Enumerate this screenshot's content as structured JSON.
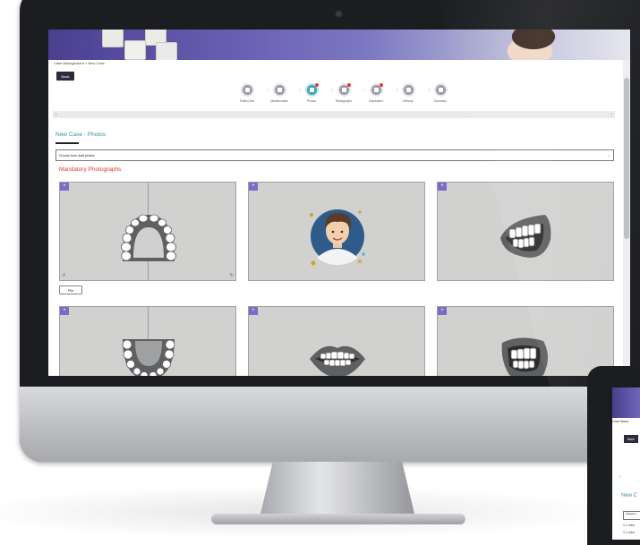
{
  "breadcrumb": "Case Management > New Case",
  "back_label": "Back",
  "steps": [
    {
      "label": "Patient Info",
      "active": false,
      "alert": false
    },
    {
      "label": "Questionnaire",
      "active": false,
      "alert": false
    },
    {
      "label": "Photos",
      "active": true,
      "alert": true
    },
    {
      "label": "Radiographs",
      "active": false,
      "alert": true
    },
    {
      "label": "Impression",
      "active": false,
      "alert": true
    },
    {
      "label": "Delivery",
      "active": false,
      "alert": false
    },
    {
      "label": "Summary",
      "active": false,
      "alert": false
    }
  ],
  "section_title": "New Case - Photos",
  "draft_select": "Choose from draft photos",
  "mandatory_title": "Mandatory Photographs",
  "card_plus": "+",
  "file_button": "File",
  "tablet": {
    "breadcrumb": "Case Mana",
    "back_label": "Back",
    "title": "New C",
    "select": "Choose f",
    "list_item_1": "1.1 crea",
    "list_item_2": "1.1 crea"
  },
  "colors": {
    "accent_teal": "#3fa3b5",
    "mandatory_red": "#e5362b",
    "plus_purple": "#7a6cc4",
    "card_gray": "#d1d2d0"
  }
}
